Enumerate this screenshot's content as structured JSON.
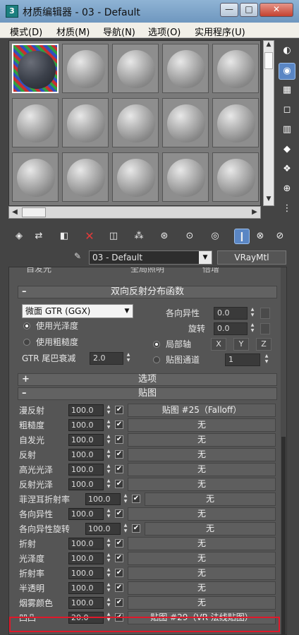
{
  "window": {
    "icon_text": "3",
    "title": "材质编辑器 - 03 - Default",
    "minimize": "—",
    "maximize": "□",
    "close": "✕"
  },
  "menu": [
    "模式(D)",
    "材质(M)",
    "导航(N)",
    "选项(O)",
    "实用程序(U)"
  ],
  "slots": {
    "rows": 3,
    "cols": 5,
    "active_index": 0
  },
  "material": {
    "name": "03 - Default",
    "type": "VRayMtl"
  },
  "cutoff_row": {
    "label1": "自发光",
    "label2": "全局照明",
    "label3": "倍增"
  },
  "brdf": {
    "rollout_title": "双向反射分布函数",
    "type_value": "微面 GTR (GGX)",
    "radio_glossiness": "使用光泽度",
    "radio_roughness": "使用粗糙度",
    "gtr_label": "GTR 尾巴衰减",
    "gtr_value": "2.0",
    "anisotropy_label": "各向异性",
    "anisotropy_value": "0.0",
    "rotation_label": "旋转",
    "rotation_value": "0.0",
    "local_axis": "局部轴",
    "axes": [
      "X",
      "Y",
      "Z"
    ],
    "map_channel": "贴图通道",
    "map_channel_value": "1"
  },
  "options_rollout": "选项",
  "maps_rollout": "贴图",
  "maps": [
    {
      "label": "漫反射",
      "value": "100.0",
      "checked": "✔",
      "map": "贴图 #25（Falloff）"
    },
    {
      "label": "粗糙度",
      "value": "100.0",
      "checked": "✔",
      "map": "无"
    },
    {
      "label": "自发光",
      "value": "100.0",
      "checked": "✔",
      "map": "无"
    },
    {
      "label": "反射",
      "value": "100.0",
      "checked": "✔",
      "map": "无"
    },
    {
      "label": "高光光泽",
      "value": "100.0",
      "checked": "✔",
      "map": "无"
    },
    {
      "label": "反射光泽",
      "value": "100.0",
      "checked": "✔",
      "map": "无"
    },
    {
      "label": "菲涅耳折射率",
      "value": "100.0",
      "checked": "✔",
      "map": "无"
    },
    {
      "label": "各向异性",
      "value": "100.0",
      "checked": "✔",
      "map": "无"
    },
    {
      "label": "各向异性旋转",
      "value": "100.0",
      "checked": "✔",
      "map": "无"
    },
    {
      "label": "折射",
      "value": "100.0",
      "checked": "✔",
      "map": "无"
    },
    {
      "label": "光泽度",
      "value": "100.0",
      "checked": "✔",
      "map": "无"
    },
    {
      "label": "折射率",
      "value": "100.0",
      "checked": "✔",
      "map": "无"
    },
    {
      "label": "半透明",
      "value": "100.0",
      "checked": "✔",
      "map": "无"
    },
    {
      "label": "烟雾颜色",
      "value": "100.0",
      "checked": "✔",
      "map": "无"
    },
    {
      "label": "凹凸",
      "value": "20.0",
      "checked": "✔",
      "map": "贴图 #29（VR-法线贴图）"
    }
  ],
  "colors": {
    "highlight": "#e0182a",
    "active_tool": "#5a86c4"
  }
}
